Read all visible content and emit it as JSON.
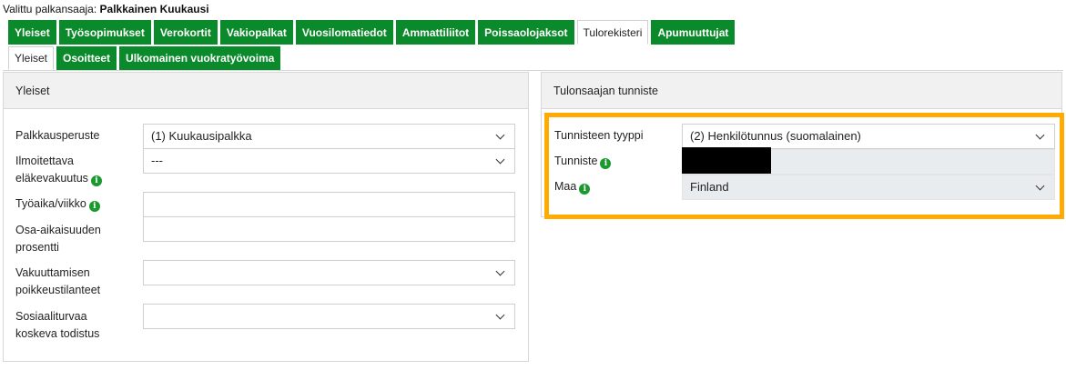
{
  "header": {
    "prefix": "Valittu palkansaaja:",
    "employee_name": "Palkkainen Kuukausi"
  },
  "tabs_row1": [
    {
      "label": "Yleiset",
      "active": false
    },
    {
      "label": "Työsopimukset",
      "active": false
    },
    {
      "label": "Verokortit",
      "active": false
    },
    {
      "label": "Vakiopalkat",
      "active": false
    },
    {
      "label": "Vuosilomatiedot",
      "active": false
    },
    {
      "label": "Ammattiliitot",
      "active": false
    },
    {
      "label": "Poissaolojaksot",
      "active": false
    },
    {
      "label": "Tulorekisteri",
      "active": true
    },
    {
      "label": "Apumuuttujat",
      "active": false
    }
  ],
  "tabs_row2": [
    {
      "label": "Yleiset",
      "active": true
    },
    {
      "label": "Osoitteet",
      "active": false
    },
    {
      "label": "Ulkomainen vuokratyövoima",
      "active": false
    }
  ],
  "left_panel": {
    "title": "Yleiset",
    "fields": {
      "palkkausperuste": {
        "label": "Palkkausperuste",
        "value": "(1) Kuukausipalkka"
      },
      "elakevakuutus": {
        "label_line1": "Ilmoitettava",
        "label_line2": "eläkevakuutus",
        "value": "---"
      },
      "tyoaika": {
        "label": "Työaika/viikko",
        "value": ""
      },
      "osa_aikaisuus": {
        "label_line1": "Osa-aikaisuuden",
        "label_line2": "prosentti",
        "value": ""
      },
      "vakuuttaminen": {
        "label_line1": "Vakuuttamisen",
        "label_line2": "poikkeustilanteet",
        "value": ""
      },
      "sosiaaliturva": {
        "label_line1": "Sosiaaliturvaa",
        "label_line2": "koskeva todistus",
        "value": ""
      }
    }
  },
  "right_panel": {
    "title": "Tulonsaajan tunniste",
    "fields": {
      "tunnisteen_tyyppi": {
        "label": "Tunnisteen tyyppi",
        "value": "(2) Henkilötunnus (suomalainen)"
      },
      "tunniste": {
        "label": "Tunniste",
        "value": ""
      },
      "maa": {
        "label": "Maa",
        "value": "Finland"
      }
    }
  },
  "icons": {
    "info": "info-icon",
    "dropdown": "chevron-down-icon"
  },
  "colors": {
    "tab_green": "#0a8a2a",
    "info_green": "#1a9a2e",
    "highlight_orange": "#ffab00",
    "panel_header_bg": "#f1f1f1",
    "readonly_bg": "#e9ecef"
  }
}
